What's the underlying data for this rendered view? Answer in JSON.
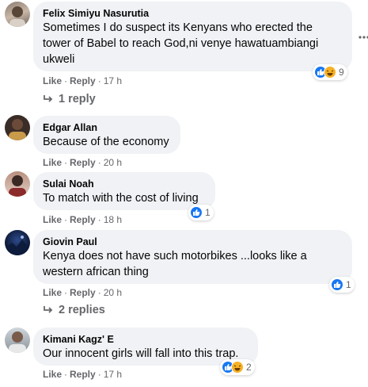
{
  "actions": {
    "like": "Like",
    "reply": "Reply",
    "separator": "·"
  },
  "colors": {
    "like_blue": "#1877f2",
    "haha_yellow": "#f7b125",
    "meta_gray": "#65676b",
    "bubble_bg": "#f0f2f5"
  },
  "comments": [
    {
      "author": "Felix Simiyu Nasurutia",
      "text": "Sometimes I do suspect its Kenyans who erected the tower of Babel to reach God,ni venye hawatuambiangi ukweli",
      "time": "17 h",
      "reaction_icons": [
        "like-icon",
        "haha-icon"
      ],
      "reaction_count": "9",
      "replies": "1 reply"
    },
    {
      "author": "Edgar Allan",
      "text": "Because of the economy",
      "time": "20 h"
    },
    {
      "author": "Sulai Noah",
      "text": "To match with the cost of living",
      "time": "18 h",
      "reaction_icons": [
        "like-icon"
      ],
      "reaction_count": "1"
    },
    {
      "author": "Giovin Paul",
      "text": "Kenya does not have such motorbikes ...looks like a western african thing",
      "time": "20 h",
      "reaction_icons": [
        "like-icon"
      ],
      "reaction_count": "1",
      "replies": "2 replies"
    },
    {
      "author": "Kimani Kagz' E",
      "text": "Our innocent girls will fall into this trap.",
      "time": "17 h",
      "reaction_icons": [
        "like-icon",
        "haha-icon"
      ],
      "reaction_count": "2"
    }
  ]
}
